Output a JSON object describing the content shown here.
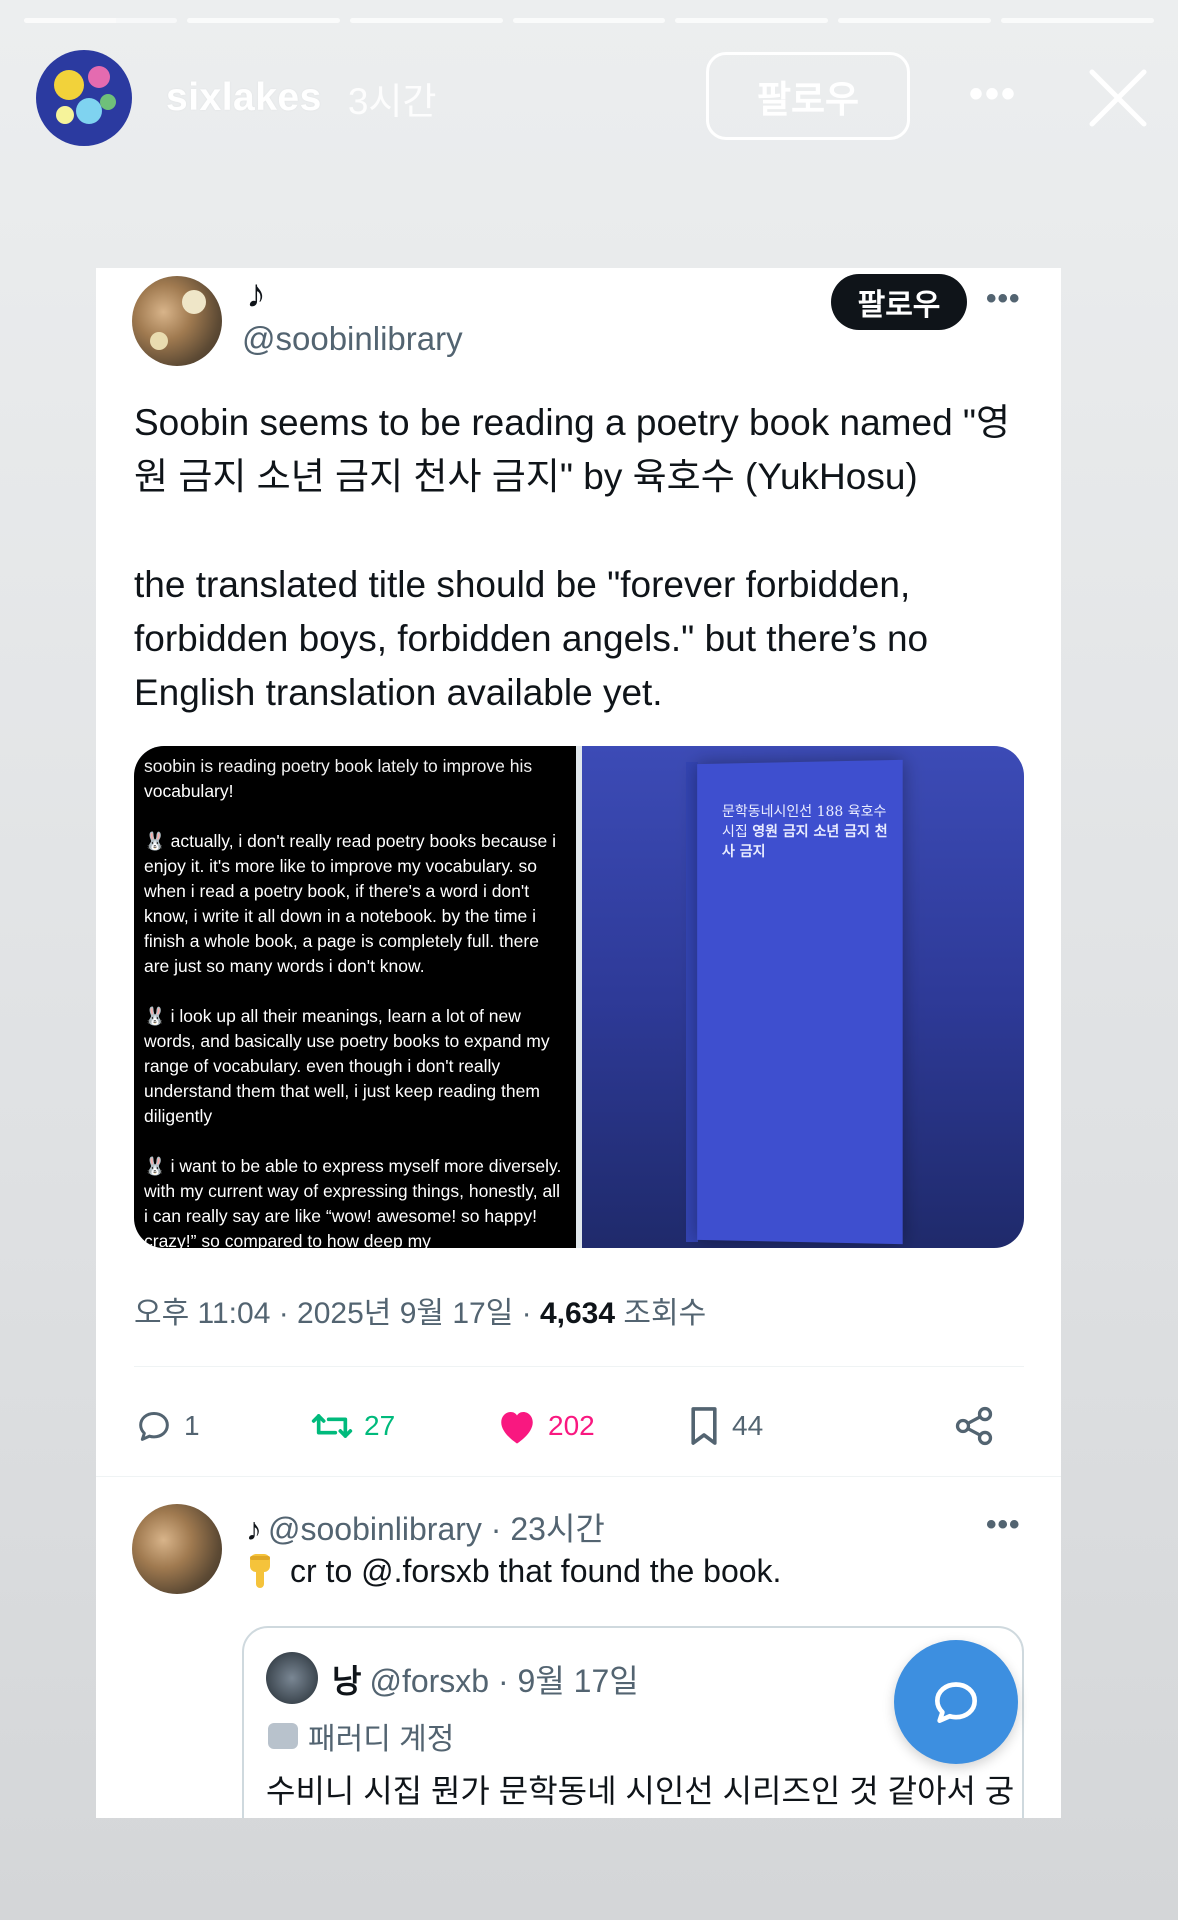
{
  "story": {
    "progress_segments": [
      1,
      0,
      0,
      0,
      0,
      0,
      0
    ],
    "active_segment_progress": 0.6,
    "username": "sixlakes",
    "time_ago": "3시간",
    "follow_label": "팔로우",
    "more_label": "•••"
  },
  "tweet": {
    "display_name": "♪",
    "handle": "@soobinlibrary",
    "follow_label": "팔로우",
    "more_label": "•••",
    "text_p1": "Soobin seems to be reading a poetry book named \"영원 금지 소년 금지 천사 금지\" by 육호수 (YukHosu)",
    "text_p2": "the translated title should be \"forever forbidden, forbidden boys, forbidden angels.\" but there’s no English translation available yet.",
    "image_text": {
      "top": "soobin is reading poetry book lately to improve his",
      "p1": "vocabulary!",
      "p2": "🐰 actually, i don't really read poetry books because i enjoy it. it's more like to improve my vocabulary. so when i read a poetry book, if there's a word i don't know, i write it all down in a notebook. by the time i finish a whole book, a page is completely full. there are just so many words i don't know.",
      "p3": "🐰 i look up all their meanings, learn a lot of new words, and basically use poetry books to expand my range of vocabulary. even though i don't really understand them that well, i just keep reading them diligently",
      "p4": "🐰 i want to be able to express myself more diversely. with my current way of expressing things, honestly, all i can really say are like “wow! awesome! so happy! crazy!” so compared to how deep my"
    },
    "book": {
      "series": "문학동네시인선 188 육호수 시집",
      "title": "영원 금지 소년 금지 천사 금지"
    },
    "meta_time": "오후 11:04 · 2025년 9월 17일 · ",
    "meta_views": "4,634",
    "meta_views_label": " 조회수",
    "actions": {
      "replies": "1",
      "retweets": "27",
      "likes": "202",
      "bookmarks": "44"
    },
    "colors": {
      "retweet": "#00ba7c",
      "like": "#f91880",
      "muted": "#536471"
    }
  },
  "reply": {
    "name": "♪",
    "handle_time": "@soobinlibrary · 23시간",
    "more_label": "•••",
    "text": "cr to @.forsxb that found the book.",
    "quote": {
      "name": "낭",
      "handle_time": "@forsxb · 9월 17일",
      "badge": "패러디 계정",
      "text": "수비니 시집 뭔가 문학동네 시인선 시리즈인 것 같아서 궁"
    }
  }
}
